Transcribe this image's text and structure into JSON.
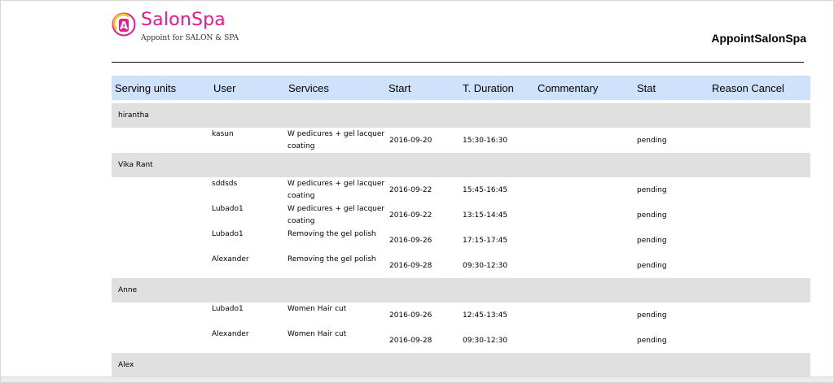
{
  "header": {
    "logo_letter": "A",
    "logo_name": "SalonSpa",
    "logo_tagline": "Appoint for SALON & SPA",
    "title": "AppointSalonSpa"
  },
  "colors": {
    "brand": "#e6198f",
    "logo_accent": "#f5c518",
    "table_header": "#cfe2fc",
    "group_row": "#e0e0e0"
  },
  "table": {
    "columns": [
      "Serving units",
      "User",
      "Services",
      "Start",
      "T. Duration",
      "Commentary",
      "Stat",
      "Reason Cancel"
    ],
    "groups": [
      {
        "name": "hirantha",
        "rows": [
          {
            "user": "kasun",
            "services": "W pedicures + gel lacquer coating",
            "start": "2016-09-20",
            "duration": "15:30-16:30",
            "commentary": "",
            "stat": "pending",
            "reason": ""
          }
        ]
      },
      {
        "name": "Vika Rant",
        "rows": [
          {
            "user": "sddsds",
            "services": "W pedicures + gel lacquer coating",
            "start": "2016-09-22",
            "duration": "15:45-16:45",
            "commentary": "",
            "stat": "pending",
            "reason": ""
          },
          {
            "user": "Lubado1",
            "services": "W pedicures + gel lacquer coating",
            "start": "2016-09-22",
            "duration": "13:15-14:45",
            "commentary": "",
            "stat": "pending",
            "reason": ""
          },
          {
            "user": "Lubado1",
            "services": "Removing the gel polish",
            "start": "2016-09-26",
            "duration": "17:15-17:45",
            "commentary": "",
            "stat": "pending",
            "reason": ""
          },
          {
            "user": "Alexander",
            "services": "Removing the gel polish",
            "start": "2016-09-28",
            "duration": "09:30-12:30",
            "commentary": "",
            "stat": "pending",
            "reason": ""
          }
        ]
      },
      {
        "name": "Anne",
        "rows": [
          {
            "user": "Lubado1",
            "services": "Women Hair cut",
            "start": "2016-09-26",
            "duration": "12:45-13:45",
            "commentary": "",
            "stat": "pending",
            "reason": ""
          },
          {
            "user": "Alexander",
            "services": "Women Hair cut",
            "start": "2016-09-28",
            "duration": "09:30-12:30",
            "commentary": "",
            "stat": "pending",
            "reason": ""
          }
        ]
      },
      {
        "name": "Alex",
        "rows": []
      }
    ]
  }
}
